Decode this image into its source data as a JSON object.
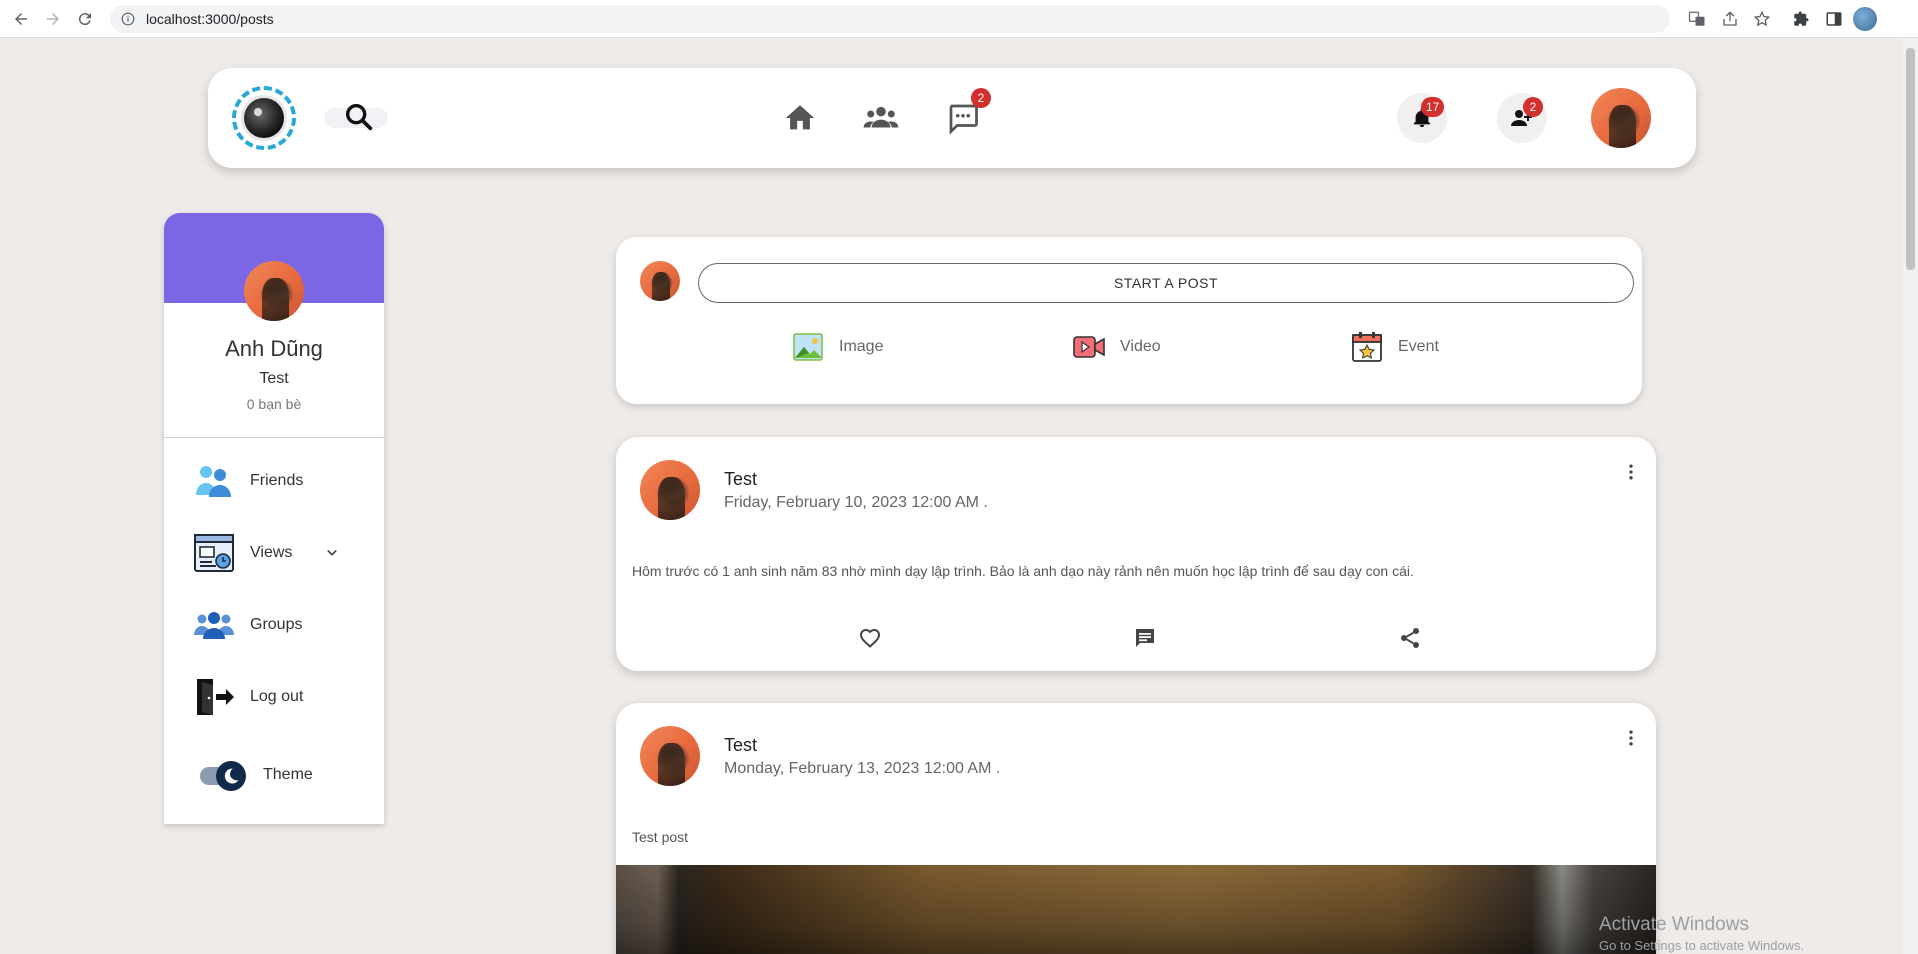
{
  "browser": {
    "url": "localhost:3000/posts"
  },
  "topbar": {
    "messages_badge": "2",
    "notifications_badge": "17",
    "friend_requests_badge": "2"
  },
  "profile": {
    "name": "Anh Dũng",
    "role": "Test",
    "friends_count": "0 bạn bè"
  },
  "sidebar": {
    "items": [
      {
        "label": "Friends",
        "icon": "friends-icon"
      },
      {
        "label": "Views",
        "icon": "views-icon"
      },
      {
        "label": "Groups",
        "icon": "groups-icon"
      },
      {
        "label": "Log out",
        "icon": "logout-icon"
      }
    ],
    "theme_label": "Theme"
  },
  "composer": {
    "start_post_label": "START A POST",
    "actions": [
      {
        "label": "Image",
        "icon": "image-icon"
      },
      {
        "label": "Video",
        "icon": "video-icon"
      },
      {
        "label": "Event",
        "icon": "event-icon"
      }
    ]
  },
  "posts": [
    {
      "author": "Test",
      "date": "Friday, February 10, 2023 12:00 AM .",
      "text": "Hôm trước có 1 anh sinh năm 83 nhờ mình dạy lập trình. Bảo là anh dạo này rảnh nên muốn học lập trình để sau dạy con cái."
    },
    {
      "author": "Test",
      "date": "Monday, February 13, 2023 12:00 AM .",
      "text": "Test post"
    }
  ],
  "watermark": {
    "line1": "Activate Windows",
    "line2": "Go to Settings to activate Windows."
  },
  "colors": {
    "page_bg": "#efebe9",
    "cover": "#7b67e5",
    "badge": "#d32f2f",
    "logo_ring": "#29a8d8"
  }
}
